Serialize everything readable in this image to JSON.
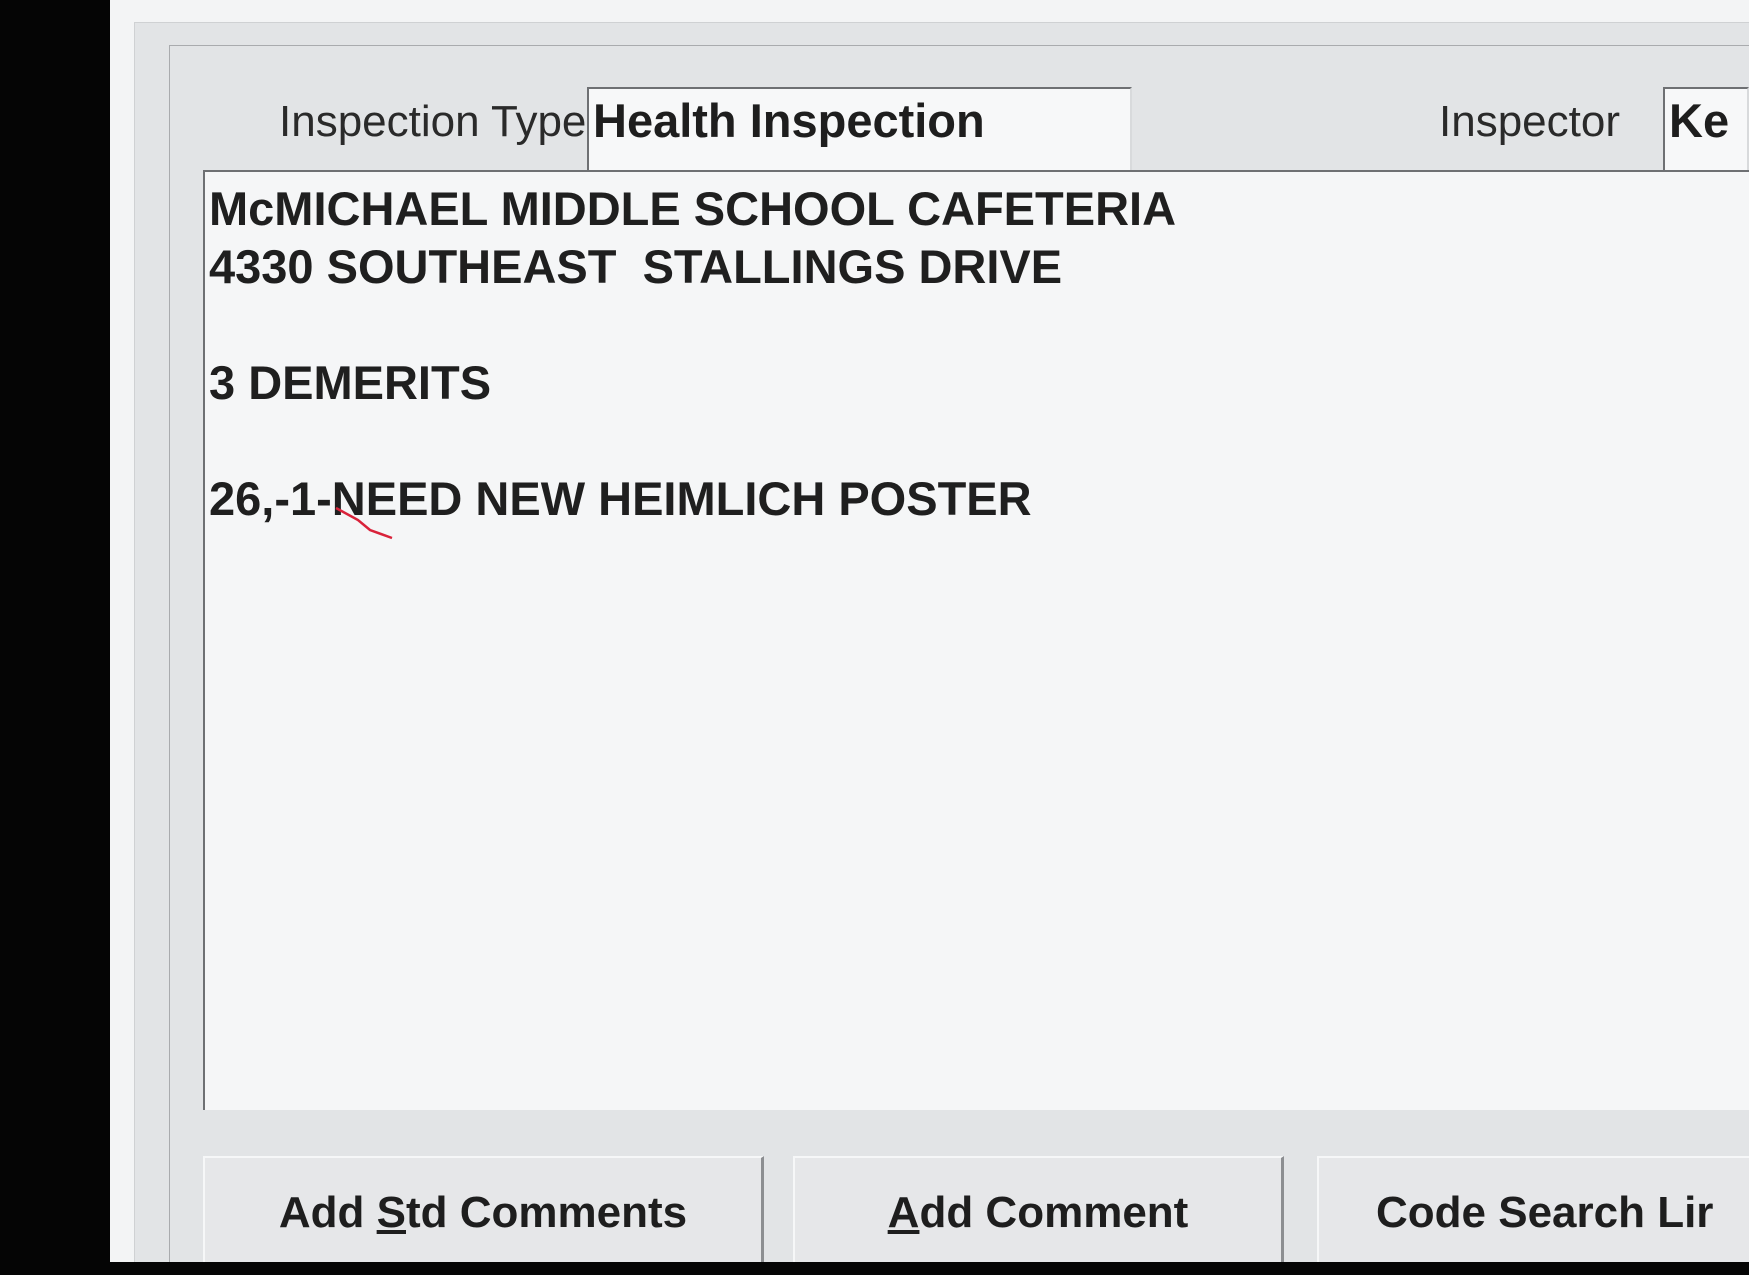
{
  "inspection_type": {
    "label": "Inspection Type",
    "value": "Health Inspection"
  },
  "inspector": {
    "label": "Inspector",
    "value": "Ke"
  },
  "comments": {
    "lines": [
      "McMICHAEL MIDDLE SCHOOL CAFETERIA",
      "4330 SOUTHEAST  STALLINGS DRIVE",
      "",
      "3 DEMERITS",
      "",
      "26,-1-NEED NEW HEIMLICH POSTER"
    ]
  },
  "buttons": {
    "add_std_comments": {
      "pre": "Add ",
      "accel": "S",
      "post": "td Comments"
    },
    "add_comment": {
      "pre": "",
      "accel": "A",
      "post": "dd Comment"
    },
    "code_search": {
      "pre": "Code Search Lir",
      "accel": "",
      "post": ""
    }
  },
  "colors": {
    "correction_mark": "#d9223a"
  }
}
